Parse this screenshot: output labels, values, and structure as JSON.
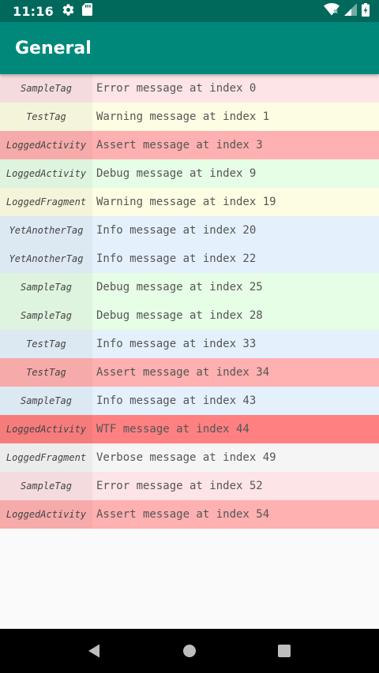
{
  "status_bar": {
    "time": "11:16"
  },
  "app_bar": {
    "title": "General"
  },
  "level_colors": {
    "error": "#fde4e6",
    "warning": "#fdfde3",
    "assert": "#ffb0b0",
    "debug": "#e6fde6",
    "info": "#e4f0fb",
    "wtf": "#ff8080",
    "verbose": "#f5f5f5"
  },
  "logs": [
    {
      "tag": "SampleTag",
      "message": "Error message at index 0",
      "level": "error"
    },
    {
      "tag": "TestTag",
      "message": "Warning message at index 1",
      "level": "warning"
    },
    {
      "tag": "LoggedActivity",
      "message": "Assert message at index 3",
      "level": "assert"
    },
    {
      "tag": "LoggedActivity",
      "message": "Debug message at index 9",
      "level": "debug"
    },
    {
      "tag": "LoggedFragment",
      "message": "Warning message at index 19",
      "level": "warning"
    },
    {
      "tag": "YetAnotherTag",
      "message": "Info message at index 20",
      "level": "info"
    },
    {
      "tag": "YetAnotherTag",
      "message": "Info message at index 22",
      "level": "info"
    },
    {
      "tag": "SampleTag",
      "message": "Debug message at index 25",
      "level": "debug"
    },
    {
      "tag": "SampleTag",
      "message": "Debug message at index 28",
      "level": "debug"
    },
    {
      "tag": "TestTag",
      "message": "Info message at index 33",
      "level": "info"
    },
    {
      "tag": "TestTag",
      "message": "Assert message at index 34",
      "level": "assert"
    },
    {
      "tag": "SampleTag",
      "message": "Info message at index 43",
      "level": "info"
    },
    {
      "tag": "LoggedActivity",
      "message": "WTF message at index 44",
      "level": "wtf"
    },
    {
      "tag": "LoggedFragment",
      "message": "Verbose message at index 49",
      "level": "verbose"
    },
    {
      "tag": "SampleTag",
      "message": "Error message at index 52",
      "level": "error"
    },
    {
      "tag": "LoggedActivity",
      "message": "Assert message at index 54",
      "level": "assert"
    }
  ]
}
